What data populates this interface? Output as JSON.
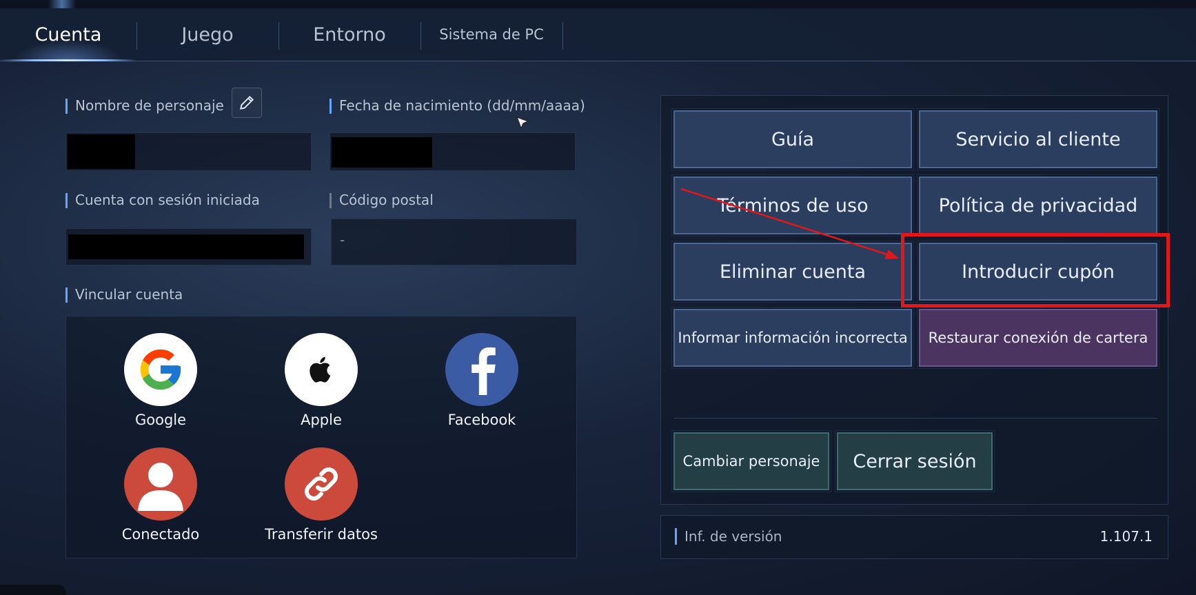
{
  "tabs": [
    {
      "label": "Cuenta",
      "active": true
    },
    {
      "label": "Juego",
      "active": false
    },
    {
      "label": "Entorno",
      "active": false
    },
    {
      "label": "Sistema de PC",
      "active": false
    }
  ],
  "account": {
    "character_name_label": "Nombre de personaje",
    "birthdate_label": "Fecha de nacimiento (dd/mm/aaaa)",
    "signed_in_label": "Cuenta con sesión iniciada",
    "postal_code_label": "Código postal",
    "postal_code_value": "-",
    "link_account_label": "Vincular cuenta"
  },
  "link_options": [
    {
      "label": "Google",
      "icon": "google-icon"
    },
    {
      "label": "Apple",
      "icon": "apple-icon"
    },
    {
      "label": "Facebook",
      "icon": "facebook-icon"
    },
    {
      "label": "Conectado",
      "icon": "user-icon"
    },
    {
      "label": "Transferir datos",
      "icon": "link-icon"
    }
  ],
  "menu_buttons": [
    {
      "label": "Guía"
    },
    {
      "label": "Servicio al cliente"
    },
    {
      "label": "Términos de uso"
    },
    {
      "label": "Política de privacidad"
    },
    {
      "label": "Eliminar cuenta"
    },
    {
      "label": "Introducir cupón"
    },
    {
      "label": "Informar información incorrecta"
    },
    {
      "label": "Restaurar conexión de cartera"
    }
  ],
  "bottom_buttons": {
    "change_character": "Cambiar personaje",
    "logout": "Cerrar sesión"
  },
  "version": {
    "label": "Inf. de versión",
    "value": "1.107.1"
  },
  "colors": {
    "accent": "#63a6ff",
    "button": "#2b3e60",
    "wallet_button": "#4b3560",
    "bottom_button": "#233e44",
    "annotation": "#e01818"
  }
}
